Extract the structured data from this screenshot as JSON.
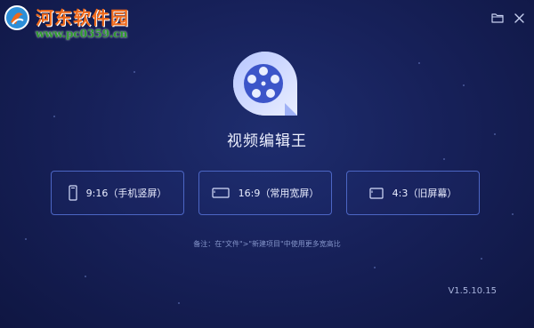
{
  "watermark": {
    "title": "河东软件园",
    "url": "www.pc0359.cn"
  },
  "window": {
    "folder_icon": "folder-icon",
    "close_icon": "close-icon"
  },
  "app": {
    "logo_icon": "film-reel-icon",
    "title": "视频编辑王"
  },
  "ratio_buttons": [
    {
      "label": "9:16（手机竖屏）",
      "icon": "portrait-screen-icon"
    },
    {
      "label": "16:9（常用宽屏）",
      "icon": "widescreen-icon"
    },
    {
      "label": "4:3（旧屏幕）",
      "icon": "standard-screen-icon"
    }
  ],
  "hint": "备注：在\"文件\">\"新建项目\"中使用更多宽高比",
  "version": "V1.5.10.15",
  "colors": {
    "background": "#17215a",
    "button_border": "#4c66c4",
    "watermark_title": "#ef6a1c",
    "watermark_url": "#2f9a2f"
  }
}
